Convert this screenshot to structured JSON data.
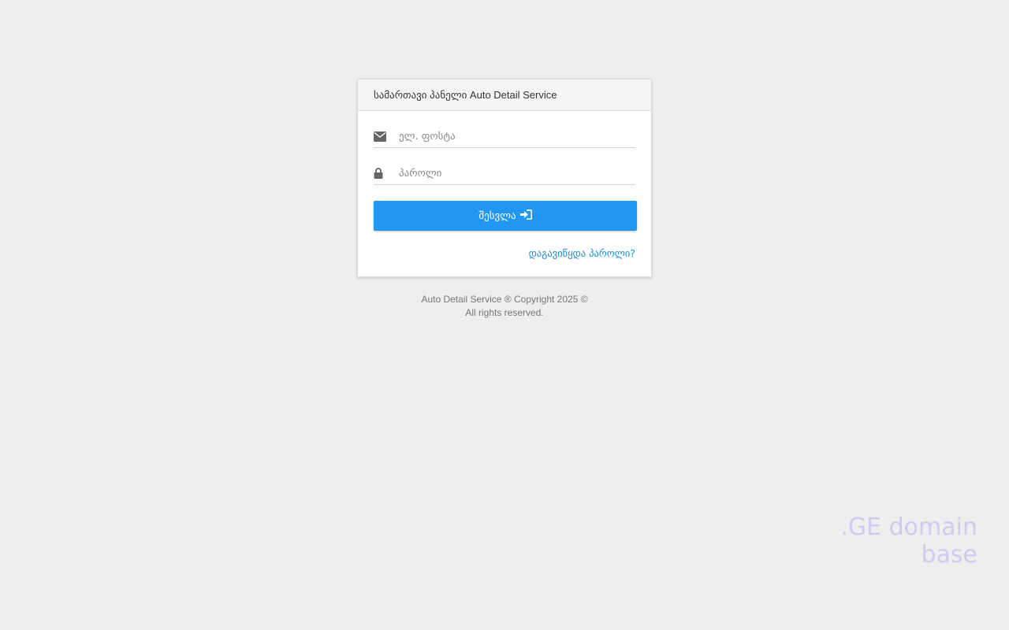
{
  "login": {
    "title": "სამართავი პანელი Auto Detail Service",
    "email_placeholder": "ელ. ფოსტა",
    "email_value": "",
    "password_placeholder": "პაროლი",
    "password_value": "",
    "submit_label": "შესვლა",
    "forgot_label": "დაგავიწყდა პაროლი?"
  },
  "icons": {
    "email": "envelope-icon",
    "password": "lock-icon",
    "submit": "sign-in-icon"
  },
  "footer": {
    "line1": "Auto Detail Service ® Copyright 2025 ©",
    "line2": "All rights reserved."
  },
  "watermark": {
    "text": ".GE domain base"
  },
  "colors": {
    "primary": "#2196f3",
    "link": "#1b8fe0",
    "background": "#eeeeee",
    "watermark": "#d3c8ee"
  }
}
